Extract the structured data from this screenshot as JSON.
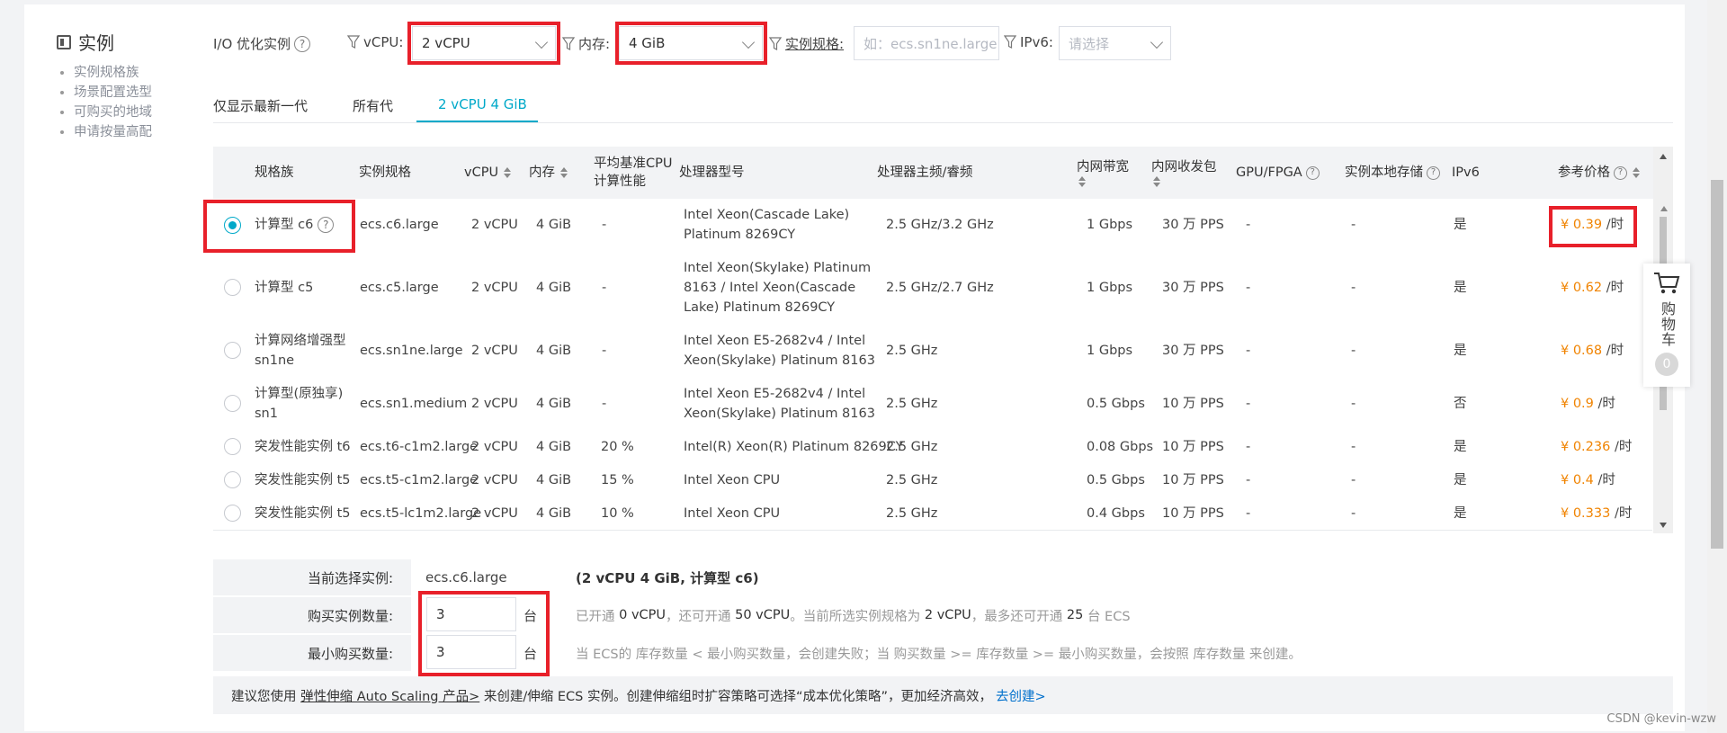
{
  "sidebar": {
    "title": "实例",
    "items": [
      "实例规格族",
      "场景配置选型",
      "可购买的地域",
      "申请按量高配"
    ]
  },
  "filters": {
    "io_label": "I/O 优化实例",
    "vcpu_label": "vCPU:",
    "vcpu_value": "2 vCPU",
    "mem_label": "内存:",
    "mem_value": "4 GiB",
    "spec_label": "实例规格:",
    "spec_placeholder": "如：ecs.sn1ne.large",
    "ipv6_label": "IPv6:",
    "ipv6_placeholder": "请选择"
  },
  "tabs": [
    "仅显示最新一代",
    "所有代",
    "2 vCPU 4 GiB"
  ],
  "table": {
    "headers": {
      "family": "规格族",
      "spec": "实例规格",
      "vcpu": "vCPU",
      "mem": "内存",
      "cpu_perf_1": "平均基准CPU",
      "cpu_perf_2": "计算性能",
      "processor": "处理器型号",
      "freq": "处理器主频/睿频",
      "bandwidth": "内网带宽",
      "pps": "内网收发包",
      "gpu": "GPU/FPGA",
      "local_storage": "实例本地存储",
      "ipv6": "IPv6",
      "price": "参考价格"
    },
    "rows": [
      {
        "family": "计算型 c6",
        "spec": "ecs.c6.large",
        "vcpu": "2 vCPU",
        "mem": "4 GiB",
        "perf": "-",
        "processor": "Intel Xeon(Cascade Lake) Platinum 8269CY",
        "freq": "2.5 GHz/3.2 GHz",
        "bw": "1 Gbps",
        "pps": "30 万 PPS",
        "gpu": "-",
        "storage": "-",
        "ipv6": "是",
        "price": "¥ 0.39",
        "unit": "/时",
        "selected": true
      },
      {
        "family": "计算型 c5",
        "spec": "ecs.c5.large",
        "vcpu": "2 vCPU",
        "mem": "4 GiB",
        "perf": "-",
        "processor": "Intel Xeon(Skylake) Platinum 8163 / Intel Xeon(Cascade Lake) Platinum 8269CY",
        "freq": "2.5 GHz/2.7 GHz",
        "bw": "1 Gbps",
        "pps": "30 万 PPS",
        "gpu": "-",
        "storage": "-",
        "ipv6": "是",
        "price": "¥ 0.62",
        "unit": "/时",
        "selected": false
      },
      {
        "family": "计算网络增强型 sn1ne",
        "spec": "ecs.sn1ne.large",
        "vcpu": "2 vCPU",
        "mem": "4 GiB",
        "perf": "-",
        "processor": "Intel Xeon E5-2682v4 / Intel Xeon(Skylake) Platinum 8163",
        "freq": "2.5 GHz",
        "bw": "1 Gbps",
        "pps": "30 万 PPS",
        "gpu": "-",
        "storage": "-",
        "ipv6": "是",
        "price": "¥ 0.68",
        "unit": "/时",
        "selected": false
      },
      {
        "family": "计算型(原独享) sn1",
        "spec": "ecs.sn1.medium",
        "vcpu": "2 vCPU",
        "mem": "4 GiB",
        "perf": "-",
        "processor": "Intel Xeon E5-2682v4 / Intel Xeon(Skylake) Platinum 8163",
        "freq": "2.5 GHz",
        "bw": "0.5 Gbps",
        "pps": "10 万 PPS",
        "gpu": "-",
        "storage": "-",
        "ipv6": "否",
        "price": "¥ 0.9",
        "unit": "/时",
        "selected": false
      },
      {
        "family": "突发性能实例 t6",
        "spec": "ecs.t6-c1m2.large",
        "vcpu": "2 vCPU",
        "mem": "4 GiB",
        "perf": "20 %",
        "processor": "Intel(R) Xeon(R) Platinum 8269CY",
        "freq": "2.5 GHz",
        "bw": "0.08 Gbps",
        "pps": "10 万 PPS",
        "gpu": "-",
        "storage": "-",
        "ipv6": "是",
        "price": "¥ 0.236",
        "unit": "/时",
        "selected": false
      },
      {
        "family": "突发性能实例 t5",
        "spec": "ecs.t5-c1m2.large",
        "vcpu": "2 vCPU",
        "mem": "4 GiB",
        "perf": "15 %",
        "processor": "Intel Xeon CPU",
        "freq": "2.5 GHz",
        "bw": "0.5 Gbps",
        "pps": "10 万 PPS",
        "gpu": "-",
        "storage": "-",
        "ipv6": "是",
        "price": "¥ 0.4",
        "unit": "/时",
        "selected": false
      },
      {
        "family": "突发性能实例 t5",
        "spec": "ecs.t5-lc1m2.large",
        "vcpu": "2 vCPU",
        "mem": "4 GiB",
        "perf": "10 %",
        "processor": "Intel Xeon CPU",
        "freq": "2.5 GHz",
        "bw": "0.4 Gbps",
        "pps": "10 万 PPS",
        "gpu": "-",
        "storage": "-",
        "ipv6": "是",
        "price": "¥ 0.333",
        "unit": "/时",
        "selected": false
      }
    ]
  },
  "cart": {
    "label": "购物车",
    "count": "0"
  },
  "selection": {
    "current_label": "当前选择实例:",
    "current_value": "ecs.c6.large",
    "current_desc": "(2 vCPU 4 GiB, 计算型 c6)",
    "qty_label": "购买实例数量:",
    "qty_value": "3",
    "qty_unit": "台",
    "qty_hint_1": "已开通",
    "qty_hint_2": "0 vCPU",
    "qty_hint_3": "，还可开通",
    "qty_hint_4": "50 vCPU",
    "qty_hint_5": "。当前所选实例规格为",
    "qty_hint_6": "2 vCPU",
    "qty_hint_7": "，最多还可开通",
    "qty_hint_8": "25",
    "qty_hint_9": "台 ECS",
    "min_label": "最小购买数量:",
    "min_value": "3",
    "min_unit": "台",
    "min_hint": "当 ECS的 库存数量 < 最小购买数量，会创建失败；当 购买数量 >= 库存数量 >= 最小购买数量，会按照 库存数量 来创建。"
  },
  "tip": {
    "prefix": "建议您使用",
    "link_product": "弹性伸缩 Auto Scaling 产品>",
    "middle": "来创建/伸缩 ECS 实例。创建伸缩组时扩容策略可选择“成本优化策略”，更加经济高效，",
    "link_create": "去创建>"
  },
  "watermark": "CSDN @kevin-wzw",
  "colors": {
    "accent": "#00a9c9",
    "price": "#f08300",
    "highlight": "#e8202a"
  }
}
